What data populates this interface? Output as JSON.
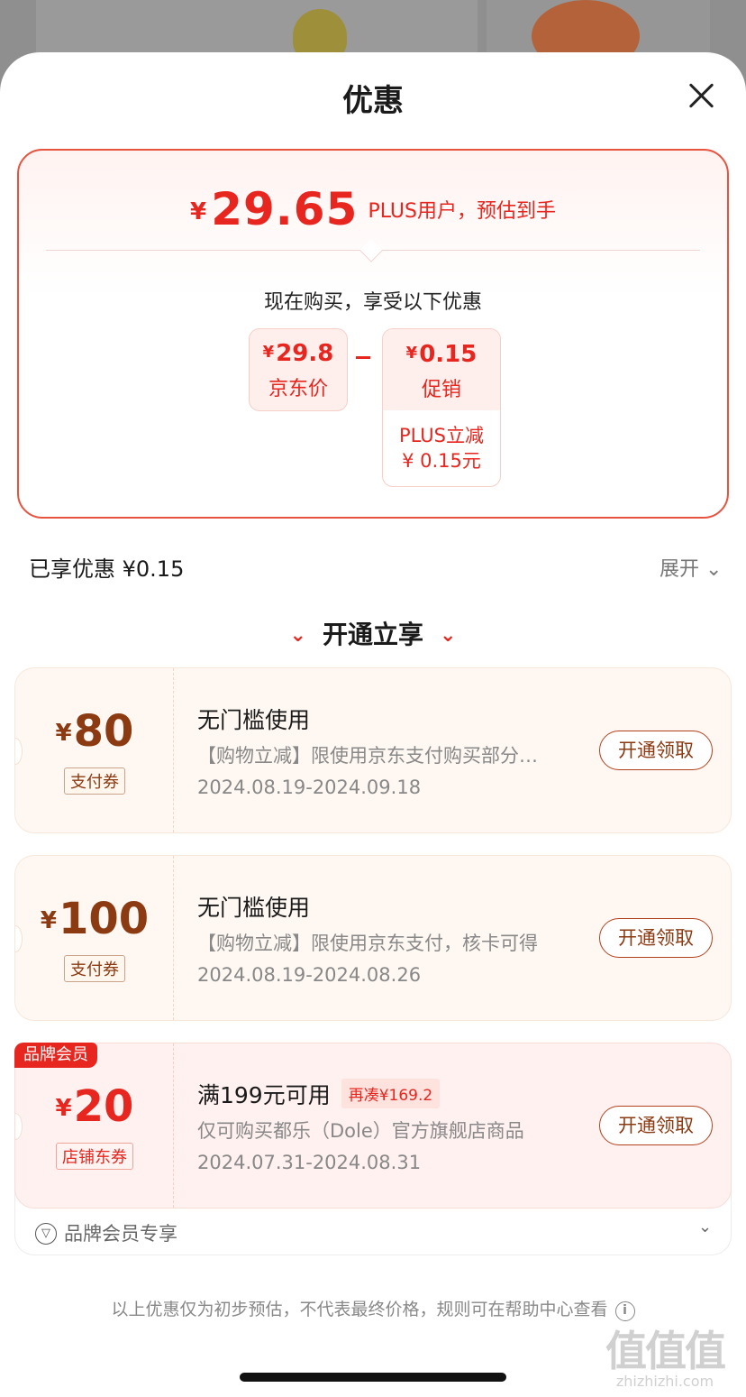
{
  "sheet": {
    "title": "优惠",
    "close_icon": "close-icon"
  },
  "summary": {
    "currency": "¥",
    "final_price": "29.65",
    "final_note": "PLUS用户，预估到手",
    "buy_now_text": "现在购买，享受以下优惠",
    "jd_price": {
      "currency": "¥",
      "amount": "29.8",
      "label": "京东价"
    },
    "promo": {
      "currency": "¥",
      "amount": "0.15",
      "label": "促销",
      "sub_line1": "PLUS立减",
      "sub_line2": "¥ 0.15元"
    }
  },
  "enjoyed": {
    "label": "已享优惠 ¥0.15",
    "expand_label": "展开"
  },
  "section_title": "开通立享",
  "coupons": [
    {
      "currency": "¥",
      "value": "80",
      "tag": "支付券",
      "title": "无门槛使用",
      "desc": "【购物立减】限使用京东支付购买部分…",
      "date": "2024.08.19-2024.09.18",
      "button": "开通领取"
    },
    {
      "currency": "¥",
      "value": "100",
      "tag": "支付券",
      "title": "无门槛使用",
      "desc": "【购物立减】限使用京东支付，核卡可得",
      "date": "2024.08.19-2024.08.26",
      "button": "开通领取"
    },
    {
      "ribbon": "品牌会员",
      "currency": "¥",
      "value": "20",
      "tag": "店铺东券",
      "title": "满199元可用",
      "need_badge": "再凑¥169.2",
      "desc": "仅可购买都乐（Dole）官方旗舰店商品",
      "date": "2024.07.31-2024.08.31",
      "button": "开通领取"
    }
  ],
  "brand_footer": {
    "label": "品牌会员专享"
  },
  "disclaimer": "以上优惠仅为初步预估，不代表最终价格，规则可在帮助中心查看",
  "watermark": {
    "big": "值值值",
    "small": "zhizhizhi.com"
  },
  "colors": {
    "accent": "#e6261f",
    "coupon_brown": "#8b3a12",
    "coupon_bg": "#fff8f2"
  }
}
